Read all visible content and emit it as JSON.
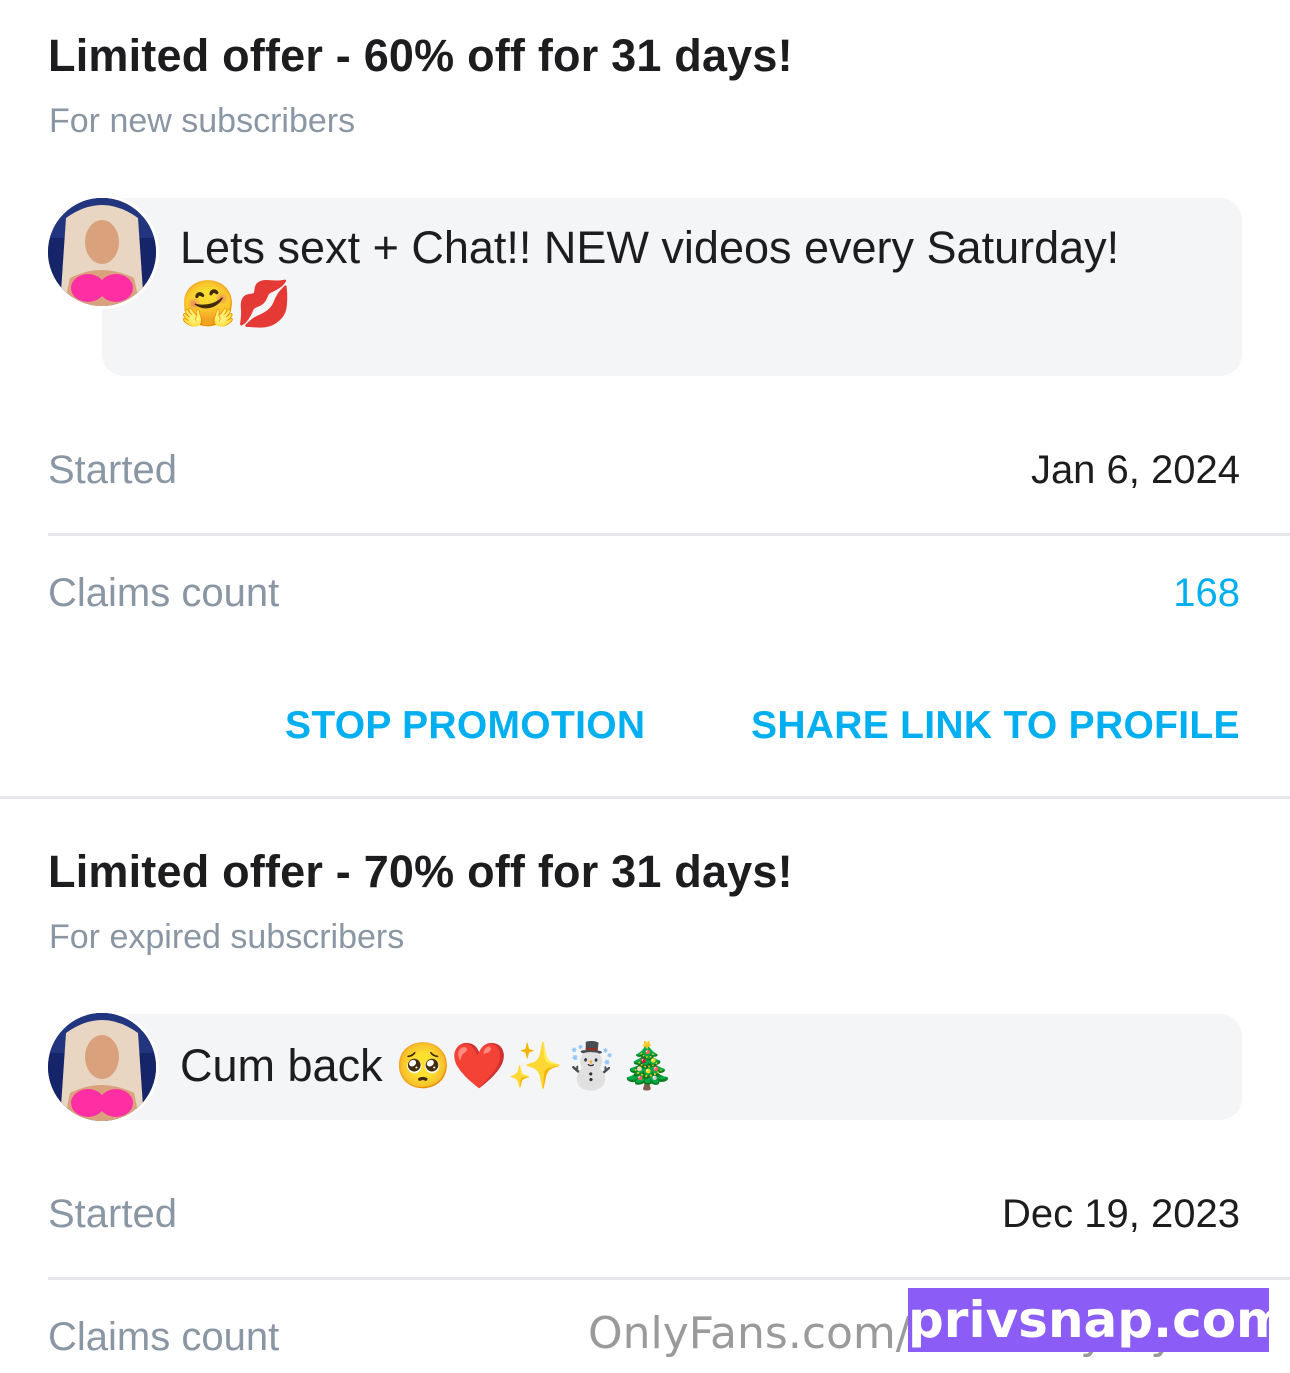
{
  "promotions": [
    {
      "title": "Limited offer - 60% off for 31 days!",
      "subtitle": "For new subscribers",
      "message": "Lets sext + Chat!! NEW videos every Saturday!",
      "message_emojis": [
        "🤗",
        "💋"
      ],
      "started_label": "Started",
      "started_value": "Jan 6, 2024",
      "claims_label": "Claims count",
      "claims_value": "168",
      "stop_label": "STOP PROMOTION",
      "share_label": "SHARE LINK TO PROFILE"
    },
    {
      "title": "Limited offer - 70% off for 31 days!",
      "subtitle": "For expired subscribers",
      "message": "Cum back",
      "message_emojis": [
        "🥺",
        "❤️",
        "✨",
        "☃️",
        "🎄"
      ],
      "started_label": "Started",
      "started_value": "Dec 19, 2023",
      "claims_label": "Claims count"
    }
  ],
  "watermarks": {
    "onlyfans": "OnlyFans.com/courtneytaylor",
    "privsnap": "privsnap.com"
  },
  "colors": {
    "accent": "#00aff0",
    "muted": "#8a96a3",
    "bubble": "#f4f5f7",
    "watermark_badge": "#8b5cf6"
  }
}
